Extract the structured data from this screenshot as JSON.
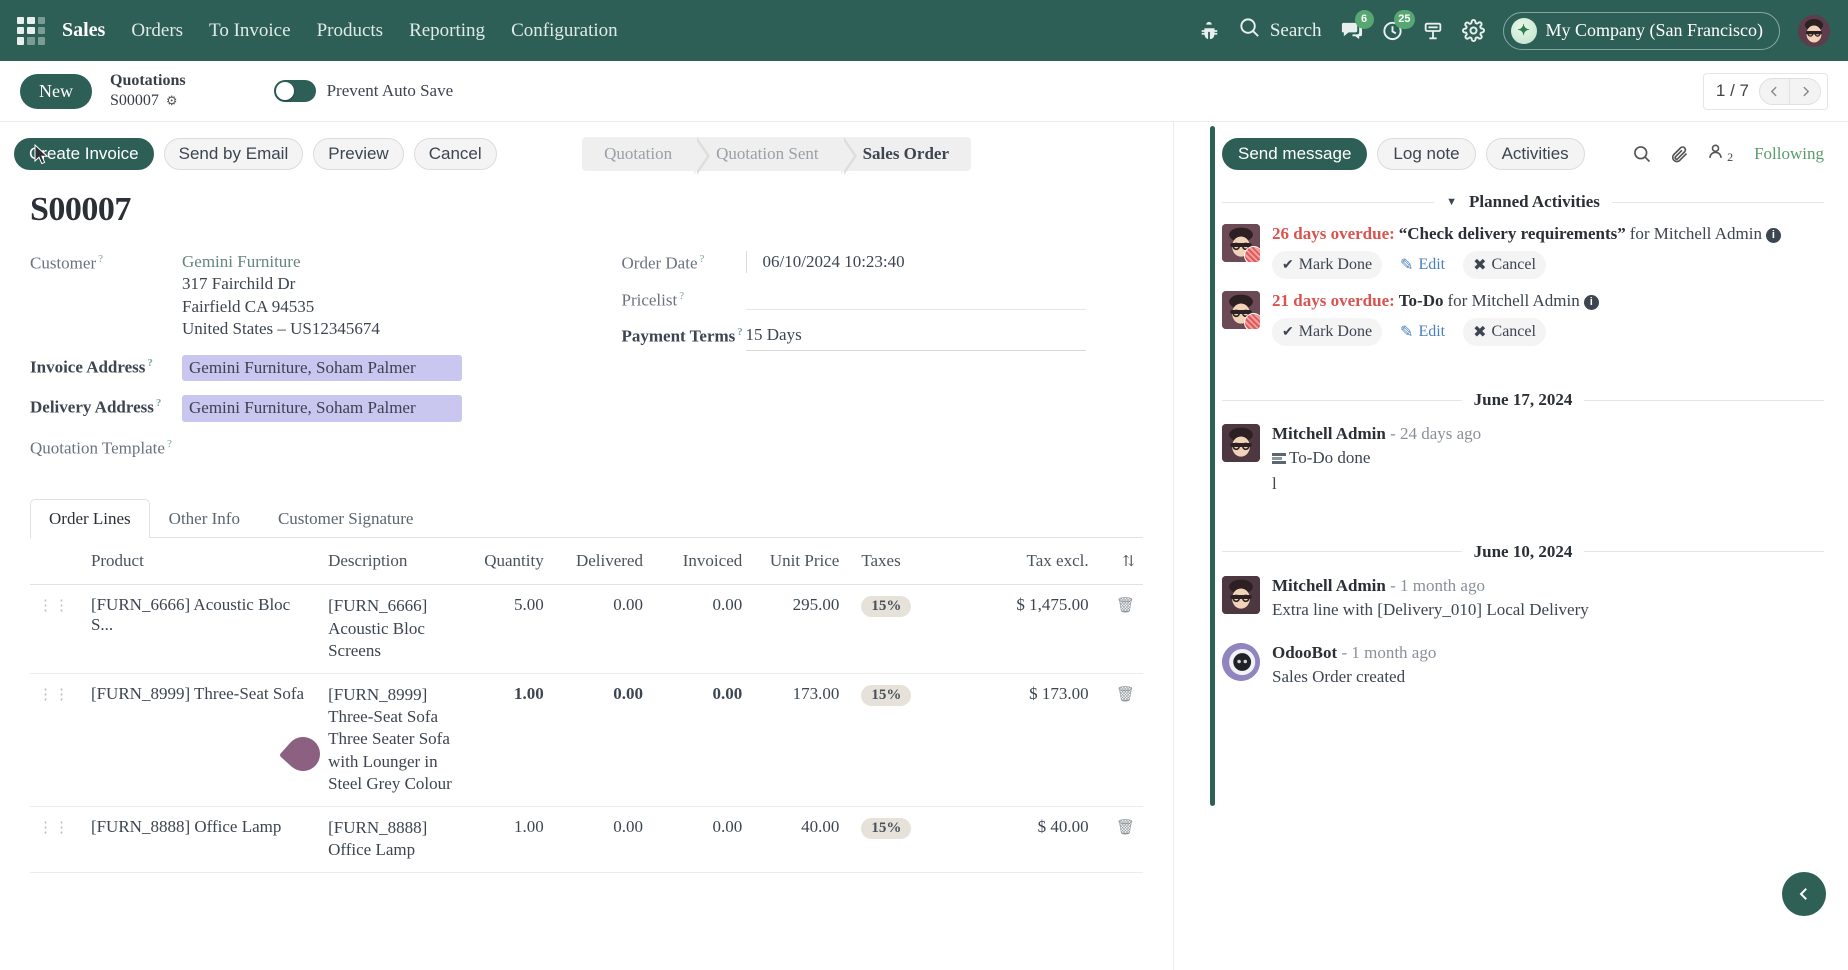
{
  "navbar": {
    "apps_icon": "grid-apps-icon",
    "brand": "Sales",
    "menu": [
      "Orders",
      "To Invoice",
      "Products",
      "Reporting",
      "Configuration"
    ],
    "bug_icon": "bug-icon",
    "search_icon": "search-icon",
    "search_label": "Search",
    "messages_icon": "chat-bubble-icon",
    "messages_badge": "6",
    "activities_icon": "clock-icon",
    "activities_badge": "25",
    "mail_icon": "mail-gateway-icon",
    "settings_icon": "gear-icon",
    "company_logo_icon": "company-leaf-icon",
    "company": "My Company (San Francisco)",
    "avatar_icon": "user-avatar"
  },
  "control": {
    "new_label": "New",
    "breadcrumb_parent": "Quotations",
    "breadcrumb_current": "S00007",
    "gear_icon": "gear-icon",
    "toggle_label": "Prevent Auto Save",
    "toggle_state": "off",
    "pager_value": "1 / 7",
    "prev_icon": "chevron-left-icon",
    "next_icon": "chevron-right-icon"
  },
  "actions": {
    "buttons": [
      {
        "label": "Create Invoice",
        "primary": true
      },
      {
        "label": "Send by Email",
        "primary": false
      },
      {
        "label": "Preview",
        "primary": false
      },
      {
        "label": "Cancel",
        "primary": false
      }
    ]
  },
  "statusbar": {
    "steps": [
      {
        "label": "Quotation",
        "active": false
      },
      {
        "label": "Quotation Sent",
        "active": false
      },
      {
        "label": "Sales Order",
        "active": true
      }
    ]
  },
  "record": {
    "title": "S00007",
    "left_fields": [
      {
        "label": "Customer",
        "help": "?",
        "value": "Gemini Furniture",
        "kind": "link",
        "extra_lines": [
          "317 Fairchild Dr",
          "Fairfield CA 94535",
          "United States – US12345674"
        ]
      },
      {
        "label": "Invoice Address",
        "help": "?",
        "value": "Gemini Furniture, Soham Palmer",
        "kind": "m2m",
        "bold": true
      },
      {
        "label": "Delivery Address",
        "help": "?",
        "value": "Gemini Furniture, Soham Palmer",
        "kind": "m2m",
        "bold": true
      },
      {
        "label": "Quotation Template",
        "help": "?",
        "value": "",
        "kind": "plain"
      }
    ],
    "right_fields": [
      {
        "label": "Order Date",
        "help": "?",
        "value": "06/10/2024 10:23:40",
        "kind": "date"
      },
      {
        "label": "Pricelist",
        "help": "?",
        "value": "",
        "kind": "empty"
      },
      {
        "label": "Payment Terms",
        "help": "?",
        "value": "15 Days",
        "kind": "underline",
        "bold": true
      }
    ]
  },
  "tabs": [
    {
      "label": "Order Lines",
      "active": true
    },
    {
      "label": "Other Info",
      "active": false
    },
    {
      "label": "Customer Signature",
      "active": false
    }
  ],
  "lines_table": {
    "columns": [
      "Product",
      "Description",
      "Quantity",
      "Delivered",
      "Invoiced",
      "Unit Price",
      "Taxes",
      "Tax excl."
    ],
    "optional_columns_icon": "column-options-icon",
    "drag_icon": "drag-handle-icon",
    "delete_icon": "trash-icon",
    "rows": [
      {
        "product": "[FURN_6666] Acoustic Bloc S...",
        "description": "[FURN_6666] Acoustic Bloc Screens",
        "quantity": "5.00",
        "delivered": "0.00",
        "invoiced": "0.00",
        "unit_price": "295.00",
        "taxes": "15%",
        "tax_excl": "$ 1,475.00",
        "highlight": false
      },
      {
        "product": "[FURN_8999] Three-Seat Sofa",
        "description": "[FURN_8999] Three-Seat Sofa Three Seater Sofa with Lounger in Steel Grey Colour",
        "quantity": "1.00",
        "delivered": "0.00",
        "invoiced": "0.00",
        "unit_price": "173.00",
        "taxes": "15%",
        "tax_excl": "$ 173.00",
        "highlight": true
      },
      {
        "product": "[FURN_8888] Office Lamp",
        "description": "[FURN_8888] Office Lamp",
        "quantity": "1.00",
        "delivered": "0.00",
        "invoiced": "0.00",
        "unit_price": "40.00",
        "taxes": "15%",
        "tax_excl": "$ 40.00",
        "highlight": false
      }
    ]
  },
  "chatter": {
    "compose_buttons": [
      {
        "label": "Send message",
        "primary": true
      },
      {
        "label": "Log note",
        "primary": false
      },
      {
        "label": "Activities",
        "primary": false
      }
    ],
    "search_icon": "search-icon",
    "attachment_icon": "paperclip-icon",
    "followers_icon": "user-icon",
    "followers_count": "2",
    "following_label": "Following",
    "planned_title": "Planned Activities",
    "collapse_icon": "caret-down-icon",
    "activities": [
      {
        "overdue": "26 days overdue:",
        "title": "“Check delivery requirements”",
        "assignee": "for Mitchell Admin",
        "info_icon": "info-icon",
        "actions": [
          {
            "label": "Mark Done",
            "icon": "check-icon"
          },
          {
            "label": "Edit",
            "icon": "pencil-icon"
          },
          {
            "label": "Cancel",
            "icon": "x-icon"
          }
        ]
      },
      {
        "overdue": "21 days overdue:",
        "title": "To-Do",
        "assignee": "for Mitchell Admin",
        "info_icon": "info-icon",
        "actions": [
          {
            "label": "Mark Done",
            "icon": "check-icon"
          },
          {
            "label": "Edit",
            "icon": "pencil-icon"
          },
          {
            "label": "Cancel",
            "icon": "x-icon"
          }
        ]
      }
    ],
    "threads": [
      {
        "date": "June 17, 2024",
        "messages": [
          {
            "author": "Mitchell Admin",
            "time": "- 24 days ago",
            "tracking_icon": "tracking-lines-icon",
            "text": "To-Do done",
            "extra": "l",
            "avatar": "mitchell-avatar"
          }
        ]
      },
      {
        "date": "June 10, 2024",
        "messages": [
          {
            "author": "Mitchell Admin",
            "time": "- 1 month ago",
            "tracking_icon": "",
            "text": "Extra line with [Delivery_010] Local Delivery",
            "extra": "",
            "avatar": "mitchell-avatar"
          },
          {
            "author": "OdooBot",
            "time": "- 1 month ago",
            "tracking_icon": "",
            "text": "Sales Order created",
            "extra": "",
            "avatar": "odoobot-avatar"
          }
        ]
      }
    ],
    "fab_icon": "chevron-left-icon"
  },
  "colors": {
    "brand": "#2e5f57",
    "accent_green": "#57a773",
    "m2m_tag": "#c9c6ef",
    "overdue_red": "#d9534f",
    "edited_teal": "#18929a"
  }
}
